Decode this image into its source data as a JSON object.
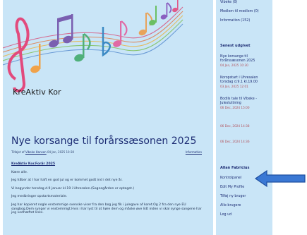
{
  "site": {
    "title": "KreAktiv Kor"
  },
  "post": {
    "title": "Nye korsange til forårssæsonen 2025",
    "meta_prefix": "Tilføjet af",
    "author": "Vibeke Hansen",
    "date": "04 Jan, 2025 10:30",
    "category": "Information",
    "subheading": "KreAktiv Kor.Forår 2025",
    "paragraphs": [
      "Kære alle.",
      "Jeg håber at I har haft en god jul og er kommet godt ind i det nye år.",
      "Vi begynder torsdag d.9 januar kl.19 i Uhresalen.(Sognegården er optaget.)",
      "Jeg medbringer opstartsmateriale.",
      "Jeg har kopieret nogle enstemmige svenske viser fra den bog jeg fik i julegave af koret.Og 2 fra den nye EU sangbog.Dem synger vi enstemmigt.Hvis i har lyst til at høre dem og måske øve lidt inden vi skal synge sangene har jeg vedhæftet links."
    ]
  },
  "sidebar": {
    "categories": [
      {
        "label": "Vibeke (0)"
      },
      {
        "label": "Medlem til medlem (0)"
      },
      {
        "label": "Information (152)"
      }
    ],
    "recent_heading": "Senest udgivet",
    "recent": [
      {
        "title": "Nye korsange til forårssæsonen 2025",
        "date": "04 Jan, 2025 10:30"
      },
      {
        "title": "Koropstart i Uhresalen torsdag d.9.1 kl.19.00",
        "date": "03 Jan, 2025 12:01"
      },
      {
        "title": "Bodils tale til Vibeke - Julesluttning",
        "date": "06 Dec, 2024 15:00"
      },
      {
        "title": "",
        "date": "06 Dec, 2024 14:38"
      },
      {
        "title": "",
        "date": "06 Dec, 2024 14:36"
      }
    ],
    "user_heading": "Allan Fabricius",
    "user_links": [
      {
        "label": "Kontrolpanel"
      },
      {
        "label": "Edit My Profile"
      },
      {
        "label": "Tilføj ny bruger"
      },
      {
        "label": "Alle brugere"
      },
      {
        "label": "Log ud"
      }
    ]
  },
  "colors": {
    "background": "#c9e5f7",
    "title_blue": "#1d2d74",
    "date_red": "#b2505a",
    "arrow_blue": "#3a78d4"
  }
}
